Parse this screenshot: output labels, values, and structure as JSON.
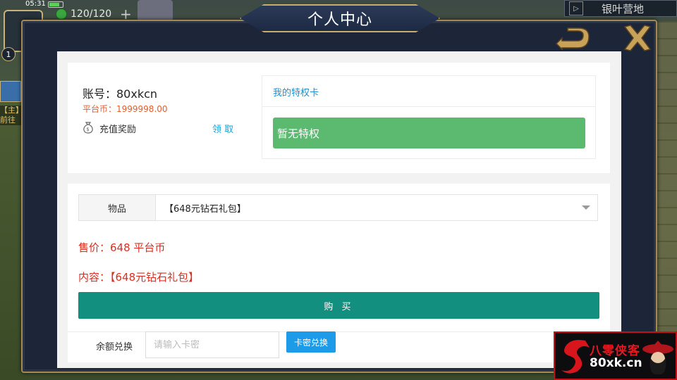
{
  "hud": {
    "time": "05:31",
    "energy": "120/120",
    "plus": "+",
    "level": "1",
    "location": "银叶营地",
    "side_tag": "【主】",
    "side_text": "前往"
  },
  "dialog": {
    "title": "个人中心"
  },
  "account": {
    "name": "账号：80xkcn",
    "coin": "平台币：1999998.00",
    "recharge_label": "充值奖励",
    "claim_label": "领 取"
  },
  "privilege": {
    "title": "我的特权卡",
    "status": "暂无特权"
  },
  "shop": {
    "item_label": "物品",
    "selected_item": "【648元钻石礼包】",
    "price": "售价：648 平台币",
    "content": "内容：【648元钻石礼包】",
    "buy_label": "购 买"
  },
  "redeem": {
    "label": "余额兑换",
    "placeholder": "请输入卡密",
    "button": "卡密兑换"
  },
  "watermark": {
    "title": "八零侠客",
    "url": "80xk.cn"
  },
  "colors": {
    "accent_green": "#5bba70",
    "buy_teal": "#128f7e",
    "redeem_blue": "#1e9be8",
    "price_red": "#d92f22",
    "coin_orange": "#e35d2a",
    "frame_gold": "#a48a52"
  }
}
